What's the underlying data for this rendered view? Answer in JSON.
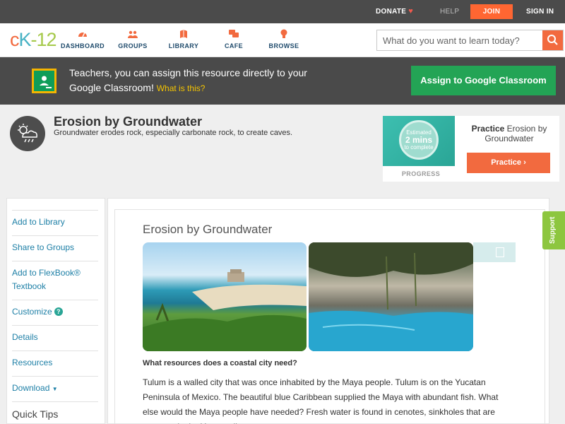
{
  "topbar": {
    "donate": "DONATE",
    "help": "HELP",
    "join": "JOIN",
    "signin": "SIGN IN"
  },
  "nav": {
    "logo": {
      "c": "c",
      "k": "K",
      "n": "-12"
    },
    "items": [
      {
        "label": "DASHBOARD"
      },
      {
        "label": "GROUPS"
      },
      {
        "label": "LIBRARY"
      },
      {
        "label": "CAFE"
      },
      {
        "label": "BROWSE"
      }
    ],
    "search_placeholder": "What do you want to learn today?"
  },
  "banner": {
    "message": "Teachers, you can assign this resource directly to your Google Classroom!",
    "what_link": "What is this?",
    "assign_button": "Assign to Google Classroom"
  },
  "header": {
    "title": "Erosion by Groundwater",
    "subtitle": "Groundwater erodes rock, especially carbonate rock, to create caves."
  },
  "practice": {
    "estimate_top": "Estimated",
    "estimate_value": "2 mins",
    "estimate_bottom": "to complete",
    "progress_label": "PROGRESS",
    "title_strong": "Practice",
    "title_rest": "Erosion by Groundwater",
    "button": "Practice"
  },
  "sidebar": {
    "items": [
      {
        "label": "Add to Library"
      },
      {
        "label": "Share to Groups"
      },
      {
        "label": "Add to FlexBook® Textbook"
      },
      {
        "label": "Customize"
      },
      {
        "label": "Details"
      },
      {
        "label": "Resources"
      },
      {
        "label": "Download"
      }
    ],
    "quick_tips": "Quick Tips"
  },
  "article": {
    "title": "Erosion by Groundwater",
    "question": "What resources does a coastal city need?",
    "paragraph": "Tulum is a walled city that was once inhabited by the Maya people. Tulum is on the Yucatan Peninsula of Mexico. The beautiful blue Caribbean supplied the Maya with abundant fish. What else would the Maya people have needed? Fresh water is found in cenotes, sinkholes that are common in the Yucatan limestone."
  },
  "support": "Support",
  "colors": {
    "accent": "#f26a3f",
    "classroom_green": "#23a455",
    "link": "#1d7fa6",
    "support_green": "#8dc63f"
  }
}
